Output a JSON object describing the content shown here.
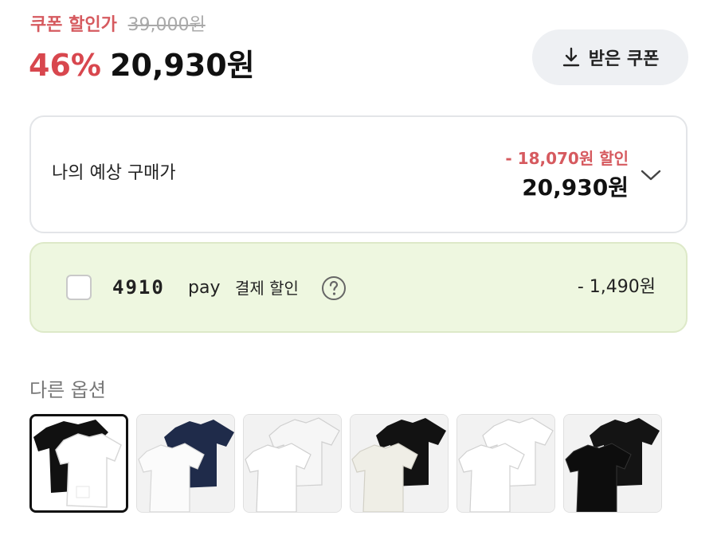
{
  "header": {
    "coupon_label": "쿠폰 할인가",
    "original_price": "39,000원",
    "discount_rate": "46%",
    "final_price": "20,930원"
  },
  "received_coupon_button": {
    "icon": "download-icon",
    "label": "받은 쿠폰"
  },
  "expected_price": {
    "label": "나의 예상 구매가",
    "discount": "- 18,070원 할인",
    "price": "20,930원",
    "icon": "chevron-down-icon"
  },
  "pay_discount": {
    "brand": "4910",
    "pay_word": "pay",
    "label": "결제 할인",
    "amount": "- 1,490원",
    "checked": false,
    "icon": "help-icon"
  },
  "other_options": {
    "title": "다른 옵션",
    "items": [
      {
        "front": "white",
        "back": "black",
        "selected": true
      },
      {
        "front": "white",
        "back": "navy",
        "selected": false
      },
      {
        "front": "white",
        "back": "lightgray",
        "selected": false
      },
      {
        "front": "cream",
        "back": "black",
        "selected": false
      },
      {
        "front": "white",
        "back": "white",
        "selected": false
      },
      {
        "front": "black",
        "back": "black",
        "selected": false
      }
    ]
  },
  "colors": {
    "accent_red": "#d65a5f",
    "pay_bg": "#eef7e0",
    "button_bg": "#eef0f3"
  }
}
